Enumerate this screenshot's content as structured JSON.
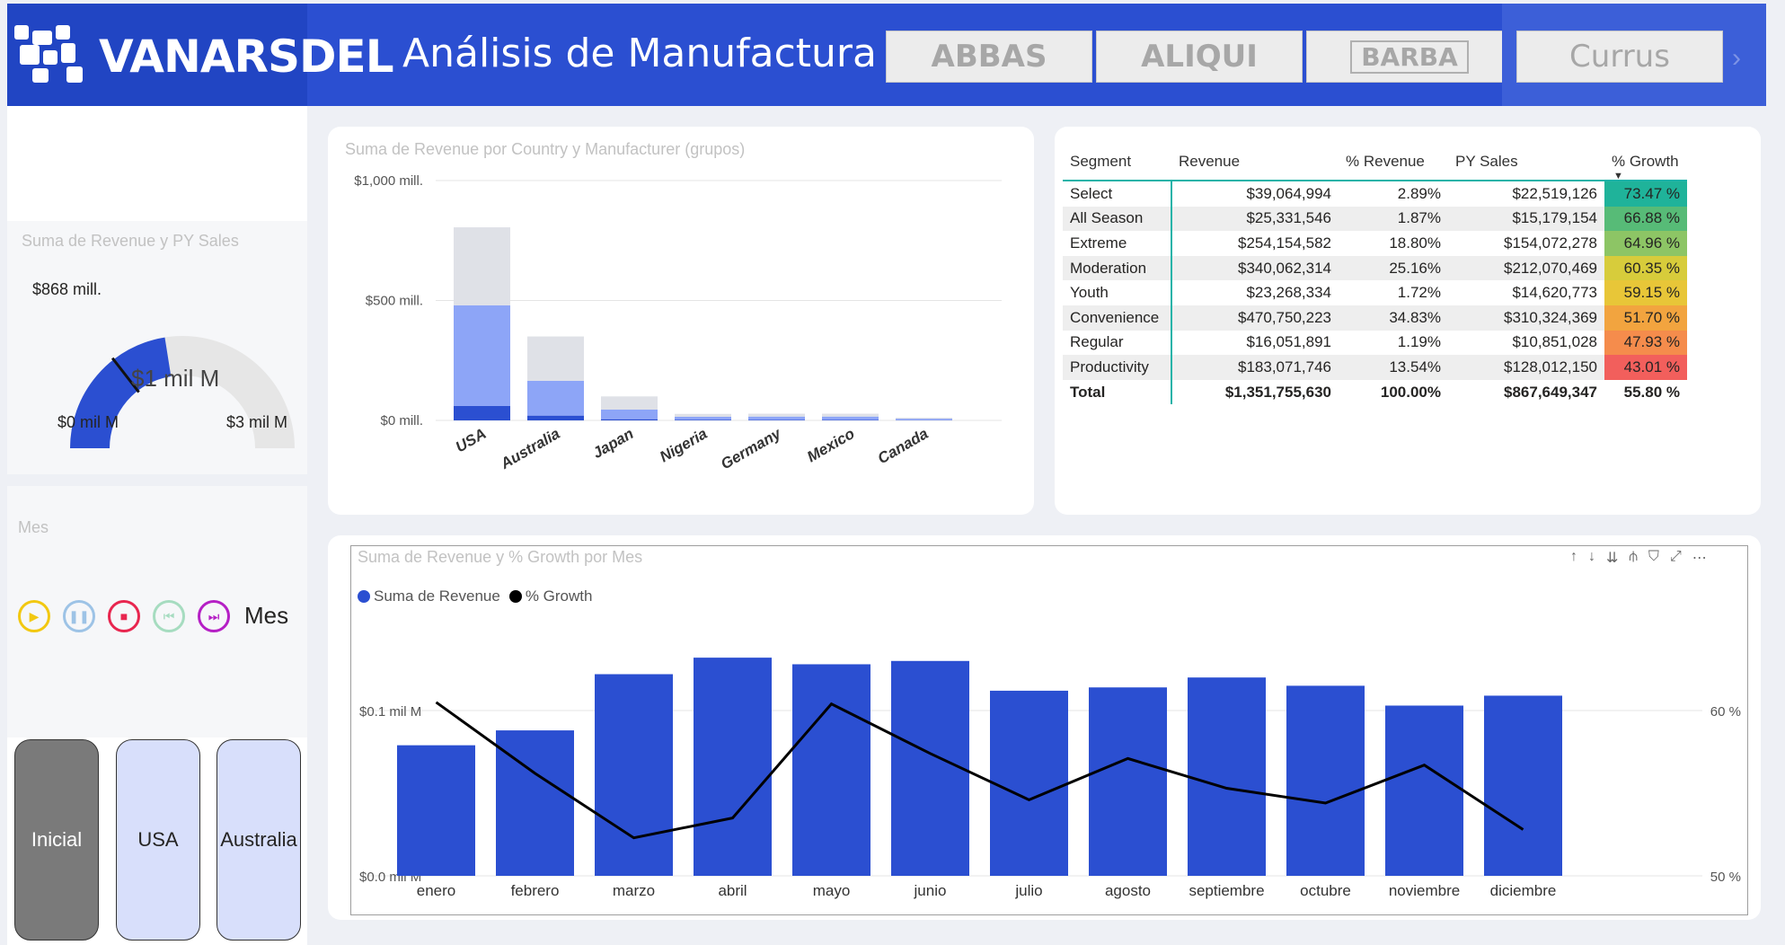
{
  "header": {
    "brand": "VANARSDEL",
    "title": "Análisis de Manufactura",
    "manufacturers": [
      "ABBAS",
      "ALIQUI",
      "BARBA",
      "Currus"
    ],
    "next_label": "›"
  },
  "gauge": {
    "title": "Suma de Revenue y PY Sales",
    "center_label": "$1 mil M",
    "min_label": "$0 mil M",
    "max_label": "$3 mil M",
    "target_label": "$868 mill.",
    "value_fraction": 0.45,
    "target_fraction": 0.29
  },
  "play_axis": {
    "title": "Mes",
    "label": "Mes",
    "controls": [
      "play",
      "pause",
      "stop",
      "previous",
      "next"
    ]
  },
  "nav_buttons": [
    "Inicial",
    "USA",
    "Australia"
  ],
  "table": {
    "headers": [
      "Segment",
      "Revenue",
      "% Revenue",
      "PY Sales",
      "% Growth"
    ],
    "rows": [
      {
        "segment": "Select",
        "revenue": "$39,064,994",
        "pct_revenue": "2.89%",
        "py_sales": "$22,519,126",
        "growth": "73.47 %",
        "color": "#1fb39a"
      },
      {
        "segment": "All Season",
        "revenue": "$25,331,546",
        "pct_revenue": "1.87%",
        "py_sales": "$15,179,154",
        "growth": "66.88 %",
        "color": "#57bb77"
      },
      {
        "segment": "Extreme",
        "revenue": "$254,154,582",
        "pct_revenue": "18.80%",
        "py_sales": "$154,072,278",
        "growth": "64.96 %",
        "color": "#8dc565"
      },
      {
        "segment": "Moderation",
        "revenue": "$340,062,314",
        "pct_revenue": "25.16%",
        "py_sales": "$212,070,469",
        "growth": "60.35 %",
        "color": "#d7cc3b"
      },
      {
        "segment": "Youth",
        "revenue": "$23,268,334",
        "pct_revenue": "1.72%",
        "py_sales": "$14,620,773",
        "growth": "59.15 %",
        "color": "#e8c638"
      },
      {
        "segment": "Convenience",
        "revenue": "$470,750,223",
        "pct_revenue": "34.83%",
        "py_sales": "$310,324,369",
        "growth": "51.70 %",
        "color": "#f2a43f"
      },
      {
        "segment": "Regular",
        "revenue": "$16,051,891",
        "pct_revenue": "1.19%",
        "py_sales": "$10,851,028",
        "growth": "47.93 %",
        "color": "#f58c4c"
      },
      {
        "segment": "Productivity",
        "revenue": "$183,071,746",
        "pct_revenue": "13.54%",
        "py_sales": "$128,012,150",
        "growth": "43.01 %",
        "color": "#f25f5c"
      }
    ],
    "total": {
      "segment": "Total",
      "revenue": "$1,351,755,630",
      "pct_revenue": "100.00%",
      "py_sales": "$867,649,347",
      "growth": "55.80 %"
    }
  },
  "chart_data": [
    {
      "type": "bar",
      "title": "Suma de Revenue por Country y Manufacturer (grupos)",
      "categories": [
        "USA",
        "Australia",
        "Japan",
        "Nigeria",
        "Germany",
        "Mexico",
        "Canada"
      ],
      "stacked": true,
      "series": [
        {
          "values": [
            60,
            20,
            5,
            3,
            2,
            2,
            1
          ],
          "color": "#2b4fd1"
        },
        {
          "values": [
            420,
            145,
            40,
            12,
            14,
            14,
            6
          ],
          "color": "#8da5f7"
        },
        {
          "values": [
            325,
            185,
            55,
            12,
            12,
            12,
            4
          ],
          "color": "#dfe1e7"
        }
      ],
      "ytick_labels": [
        "$0 mill.",
        "$500 mill.",
        "$1,000 mill."
      ],
      "yticks": [
        0,
        500,
        1000
      ],
      "ylim": [
        0,
        1000
      ]
    },
    {
      "type": "bar",
      "title": "Suma de Revenue y % Growth por Mes",
      "categories": [
        "enero",
        "febrero",
        "marzo",
        "abril",
        "mayo",
        "junio",
        "julio",
        "agosto",
        "septiembre",
        "octubre",
        "noviembre",
        "diciembre"
      ],
      "series": [
        {
          "name": "Suma de Revenue",
          "type": "bar",
          "color": "#2b4fd1",
          "values": [
            0.079,
            0.088,
            0.122,
            0.132,
            0.128,
            0.13,
            0.112,
            0.114,
            0.12,
            0.115,
            0.103,
            0.109
          ]
        },
        {
          "name": "% Growth",
          "type": "line",
          "color": "#000000",
          "values": [
            60.5,
            56.2,
            52.3,
            53.5,
            60.4,
            57.4,
            54.6,
            57.1,
            55.3,
            54.4,
            56.7,
            52.8
          ]
        }
      ],
      "y_left": {
        "ticks": [
          0.0,
          0.1
        ],
        "tick_labels": [
          "$0.0 mil M",
          "$0.1 mil M"
        ],
        "ylim": [
          0,
          0.1
        ]
      },
      "y_right": {
        "ticks": [
          50,
          60
        ],
        "tick_labels": [
          "50 %",
          "60 %"
        ],
        "ylim": [
          50,
          60
        ]
      },
      "legend": "top-left"
    }
  ]
}
